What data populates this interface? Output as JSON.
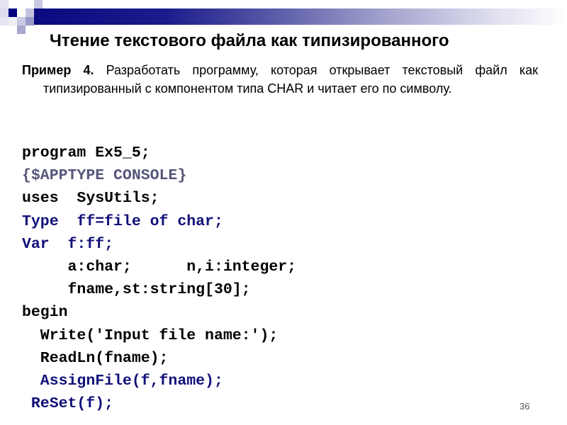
{
  "slide": {
    "title": "Чтение текстового файла как типизированного",
    "task_label": "Пример 4.",
    "task_text": " Разработать программу, которая открывает текстовый файл как типизированный с компонентом типа CHAR и читает его по символу.",
    "page_number": "36"
  },
  "colors": {
    "banner_start": "#0a0a80",
    "banner_end": "#ffffff",
    "keyword_navy": "#10107a",
    "directive_gray": "#55557a",
    "text": "#000000"
  },
  "code_lines": [
    {
      "text": "program Ex5_5;",
      "color": "black"
    },
    {
      "text": "{$APPTYPE CONSOLE}",
      "color": "gray"
    },
    {
      "text": "uses  SysUtils;",
      "color": "black"
    },
    {
      "text": "Type  ff=file of char;",
      "color": "navy"
    },
    {
      "text": "Var  f:ff;",
      "color": "navy"
    },
    {
      "text": "     a:char;      n,i:integer;",
      "color": "black"
    },
    {
      "text": "     fname,st:string[30];",
      "color": "black"
    },
    {
      "text": "begin",
      "color": "black"
    },
    {
      "text": "  Write('Input file name:');",
      "color": "black"
    },
    {
      "text": "  ReadLn(fname);",
      "color": "black"
    },
    {
      "text": "  AssignFile(f,fname);",
      "color": "navy"
    },
    {
      "text": " ReSet(f);",
      "color": "navy"
    }
  ]
}
